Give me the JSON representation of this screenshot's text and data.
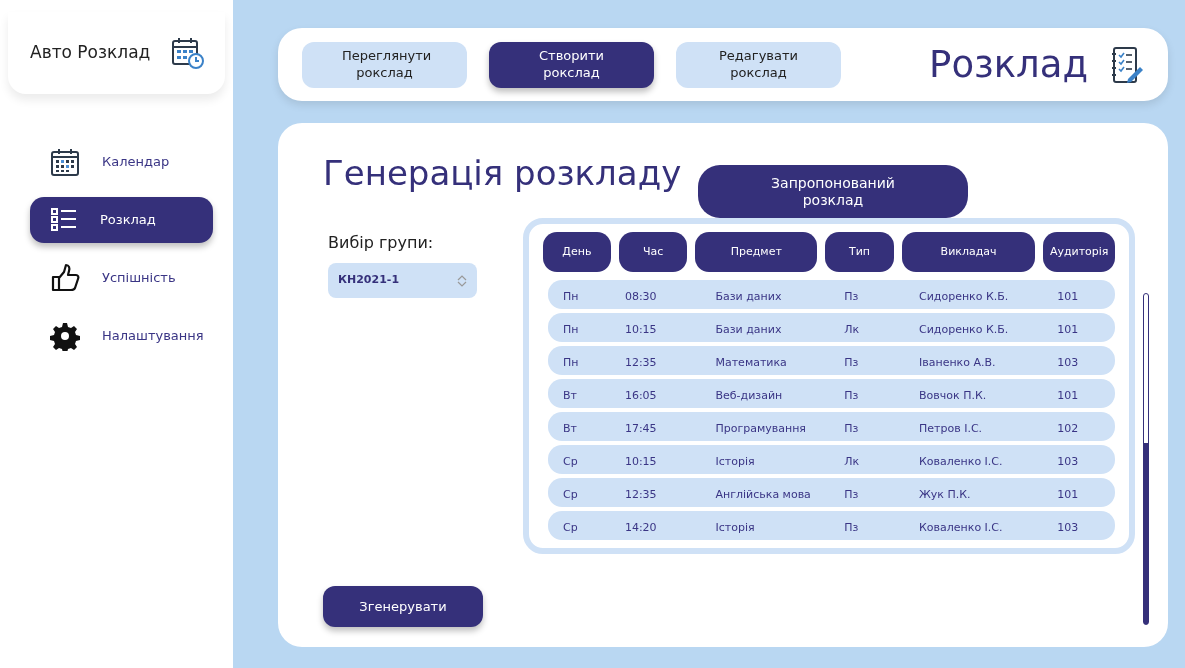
{
  "sidebar": {
    "app_title": "Авто Розклад",
    "items": [
      {
        "label": "Календар",
        "kind": "calendar",
        "selected": false
      },
      {
        "label": "Розклад",
        "kind": "list",
        "selected": true
      },
      {
        "label": "Успішність",
        "kind": "thumb",
        "selected": false
      },
      {
        "label": "Налаштування",
        "kind": "gear",
        "selected": false
      }
    ]
  },
  "top_bar": {
    "tabs": [
      {
        "label": "Переглянути рокслад",
        "selected": false
      },
      {
        "label": "Створити рокслад",
        "selected": true
      },
      {
        "label": "Редагувати рокслад",
        "selected": false
      }
    ],
    "title": "Розклад"
  },
  "main": {
    "heading": "Генерація розкладу",
    "group_label": "Вибір групи:",
    "group_select": {
      "value": "КН2021-1"
    },
    "generate_button": "Згенерувати",
    "proposed_label": "Запропонований розклад",
    "table": {
      "columns": [
        "День",
        "Час",
        "Предмет",
        "Тип",
        "Викладач",
        "Аудиторія"
      ],
      "rows": [
        [
          "Пн",
          "08:30",
          "Бази даних",
          "Пз",
          "Сидоренко К.Б.",
          "101"
        ],
        [
          "Пн",
          "10:15",
          "Бази даних",
          "Лк",
          "Сидоренко К.Б.",
          "101"
        ],
        [
          "Пн",
          "12:35",
          "Математика",
          "Пз",
          "Іваненко А.В.",
          "103"
        ],
        [
          "Вт",
          "16:05",
          "Веб-дизайн",
          "Пз",
          "Вовчок П.К.",
          "101"
        ],
        [
          "Вт",
          "17:45",
          "Програмування",
          "Пз",
          "Петров І.С.",
          "102"
        ],
        [
          "Ср",
          "10:15",
          "Історія",
          "Лк",
          "Коваленко І.С.",
          "103"
        ],
        [
          "Ср",
          "12:35",
          "Англійська мова",
          "Пз",
          "Жук П.К.",
          "101"
        ],
        [
          "Ср",
          "14:20",
          "Історія",
          "Пз",
          "Коваленко І.С.",
          "103"
        ]
      ]
    }
  }
}
